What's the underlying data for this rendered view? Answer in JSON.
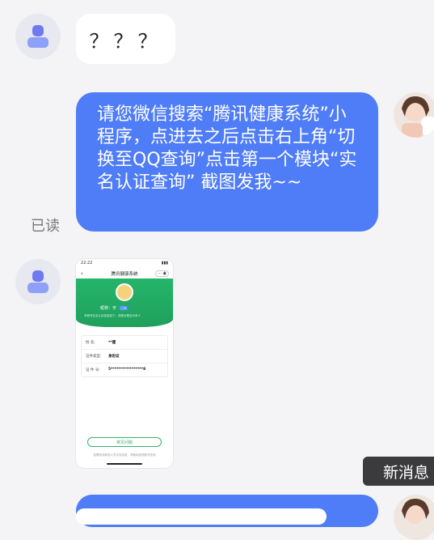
{
  "messages": [
    {
      "from": "other",
      "text": "？？？"
    },
    {
      "from": "self",
      "text": "请您微信搜索“腾讯健康系统”小程序，点进去之后点击右上角“切换至QQ查询”点击第一个模块“实名认证查询” 截图发我~~",
      "status": "已读"
    },
    {
      "from": "other",
      "type": "image",
      "screenshot": {
        "time": "22:22",
        "title": "腾讯健康系统",
        "nickname_label": "昵称：",
        "nickname_value": "宇",
        "badge": "已实",
        "subtitle": "本账号实名认证信息如下，请核对是否为本人",
        "rows": [
          {
            "key": "姓    名:",
            "value": "**建"
          },
          {
            "key": "证件类型:",
            "value": "身份证"
          },
          {
            "key": "证  件  号:",
            "value": "5*****************8"
          }
        ],
        "button": "常见问题",
        "footer": "如需查询其他人员实名信息，请使用其他账号查询"
      }
    }
  ],
  "new_message_label": "新消息",
  "colors": {
    "self_bubble": "#4f7cf7",
    "background": "#f4f4f6",
    "hero_green": "#1fa05c"
  }
}
